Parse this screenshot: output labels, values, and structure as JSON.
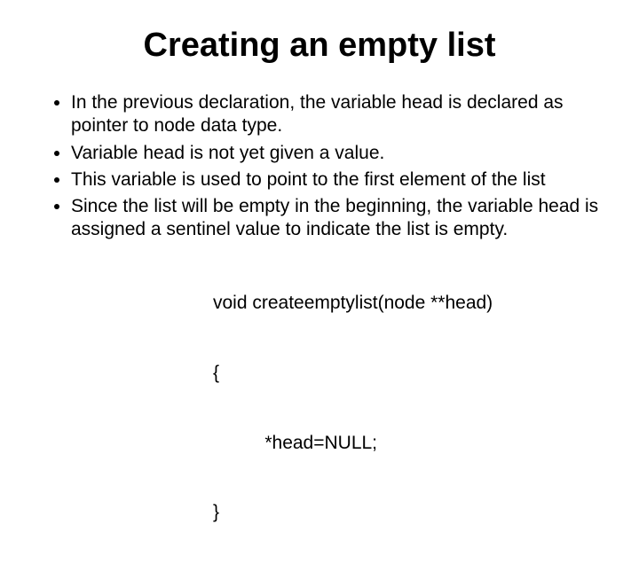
{
  "title": "Creating an empty list",
  "bullets": [
    "In the previous declaration, the variable head is declared as pointer to node data type.",
    "Variable head is not yet given a value.",
    "This variable is used to point to the first element of the list",
    "Since the list will be empty in the beginning, the variable head is assigned a sentinel value to indicate the list is empty."
  ],
  "code": {
    "line1": "void createemptylist(node **head)",
    "line2": "{",
    "line3": "          *head=NULL;",
    "line4": "}"
  }
}
